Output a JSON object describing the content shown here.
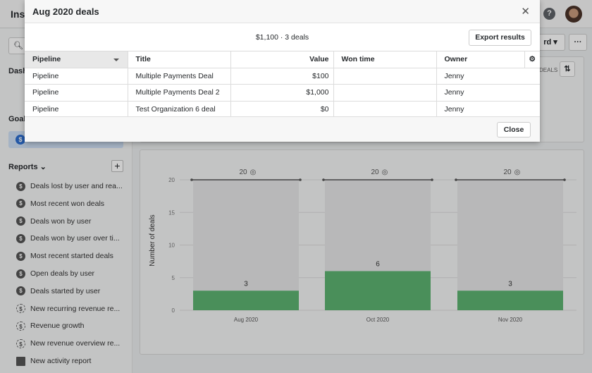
{
  "app": {
    "title": "Insi"
  },
  "sidebar": {
    "dash_label": "Dash",
    "goals_label": "Goals",
    "reports_label": "Reports",
    "reports": [
      {
        "label": "Deals lost by user and rea...",
        "icon": "dollar-icon"
      },
      {
        "label": "Most recent won deals",
        "icon": "dollar-icon"
      },
      {
        "label": "Deals won by user",
        "icon": "dollar-icon"
      },
      {
        "label": "Deals won by user over ti...",
        "icon": "dollar-icon"
      },
      {
        "label": "Most recent started deals",
        "icon": "dollar-icon"
      },
      {
        "label": "Open deals by user",
        "icon": "dollar-icon"
      },
      {
        "label": "Deals started by user",
        "icon": "dollar-icon"
      },
      {
        "label": "New recurring revenue re...",
        "icon": "recurring-revenue-icon"
      },
      {
        "label": "Revenue growth",
        "icon": "recurring-revenue-icon"
      },
      {
        "label": "New revenue overview re...",
        "icon": "recurring-revenue-icon"
      },
      {
        "label": "New activity report",
        "icon": "calendar-icon"
      }
    ]
  },
  "header": {
    "dashboard_btn": "rd",
    "more_btn": "···",
    "deals_tag": "DEALS"
  },
  "modal": {
    "title": "Aug 2020 deals",
    "summary": "$1,100 · 3 deals",
    "export_label": "Export results",
    "close_label": "Close",
    "columns": [
      "Pipeline",
      "Title",
      "Value",
      "Won time",
      "Owner"
    ],
    "rows": [
      [
        "Pipeline",
        "Multiple Payments Deal",
        "$100",
        "",
        "Jenny"
      ],
      [
        "Pipeline",
        "Multiple Payments Deal 2",
        "$1,000",
        "",
        "Jenny"
      ],
      [
        "Pipeline",
        "Test Organization 6 deal",
        "$0",
        "",
        "Jenny"
      ]
    ]
  },
  "chart_data": {
    "type": "bar",
    "categories": [
      "Aug 2020",
      "Oct 2020",
      "Nov 2020"
    ],
    "values": [
      3,
      6,
      3
    ],
    "goals": [
      20,
      20,
      20
    ],
    "ylabel": "Number of deals",
    "ylim": [
      0,
      20
    ],
    "yticks": [
      0,
      5,
      10,
      15,
      20
    ],
    "bar_color": "#5db371",
    "grid": true
  }
}
